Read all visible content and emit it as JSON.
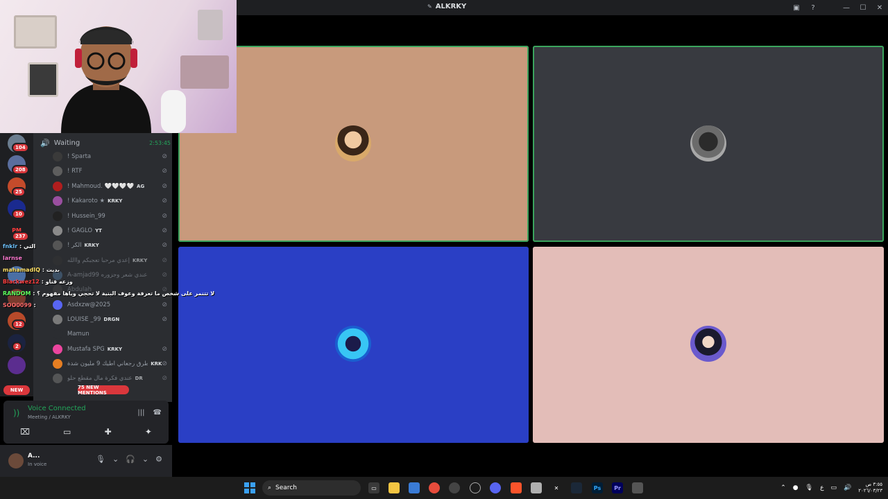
{
  "window": {
    "title": "ALKRKY"
  },
  "voice_channel": {
    "name": "Waiting",
    "timer": "2:53:45",
    "members": [
      {
        "name": "! Sparta",
        "tag": ""
      },
      {
        "name": "! RTF",
        "tag": ""
      },
      {
        "name": "! Mahmoud. 🤍🤍🤍🤍",
        "tag": "AG"
      },
      {
        "name": "! Kakaroto ★",
        "tag": "KRKY"
      },
      {
        "name": "! Hussein_99",
        "tag": ""
      },
      {
        "name": "! GAGLO",
        "tag": "YT"
      },
      {
        "name": "! الكر",
        "tag": "KRKY"
      },
      {
        "name": "إعدي مرحبا تعجبكم واالله",
        "tag": "KRKY"
      },
      {
        "name": "A-amjad99 عندي شعر وجزوره",
        "tag": ""
      },
      {
        "name": "Abdulah",
        "tag": ""
      },
      {
        "name": "Asdxzw@2025",
        "tag": ""
      },
      {
        "name": "LOUISE _99",
        "tag": "DRGN"
      },
      {
        "name": "Mamun",
        "tag": ""
      },
      {
        "name": "Mustafa SPG",
        "tag": "KRKY"
      },
      {
        "name": "اطرق رجعاني اطيك 9 مليون شدة",
        "tag": "KRK"
      },
      {
        "name": "عندي فكرة مال مقطع حلو",
        "tag": "DR"
      }
    ]
  },
  "servers": [
    {
      "badge": "104"
    },
    {
      "badge": "208"
    },
    {
      "badge": "25"
    },
    {
      "badge": "10"
    },
    {
      "badge": "237",
      "label": "PM"
    },
    {
      "badge": ""
    },
    {
      "badge": ""
    },
    {
      "badge": "12"
    },
    {
      "badge": "2"
    },
    {
      "badge": ""
    }
  ],
  "new_mentions": "75 NEW MENTIONS",
  "new_tag": "NEW",
  "voice_panel": {
    "status": "Voice Connected",
    "subtitle": "Meeting / ALKRKY"
  },
  "user": {
    "name": "A...",
    "status": "In voice"
  },
  "stream_chat": [
    {
      "user": "fnklr",
      "text": ": التي",
      "color": "#6fc3ff"
    },
    {
      "user": "larnse",
      "text": "",
      "color": "#ff7ad1"
    },
    {
      "user": "mahamadIQ",
      "text": ": بديت",
      "color": "#ffe066"
    },
    {
      "user": "Blackwez12",
      "text": ": وزعه قتاو",
      "color": "#ff4040"
    },
    {
      "user": "RANDOM",
      "text": ": لا تتنمر على شخص ما تعرفة وعوف البنية لا تحجي وياها مفهوم ؟",
      "color": "#5fff5f"
    },
    {
      "user": "SOO0099",
      "text": ":",
      "color": "#ff6b6b"
    }
  ],
  "taskbar": {
    "search_placeholder": "Search",
    "time": "٣:٥٥ ص",
    "date": "٢٠٢٦/٠٣/٢٣"
  },
  "colors": {
    "tile1": "#c89a7c",
    "tile2": "#383a40",
    "tile3": "#2a3fc5",
    "tile4": "#e3bdb8",
    "speaking": "#3ba55d",
    "discord_green": "#23a55a"
  }
}
